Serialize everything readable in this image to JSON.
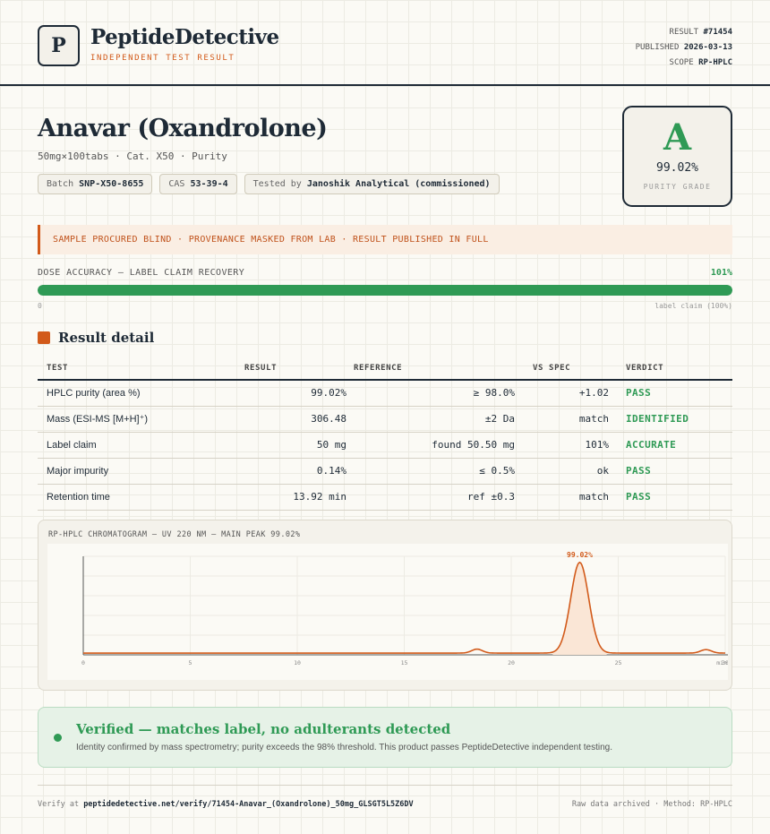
{
  "brand": {
    "logo_letter": "P",
    "name": "PeptideDetective",
    "tagline": "INDEPENDENT TEST RESULT"
  },
  "meta": {
    "result_label": "RESULT",
    "result_value": "#71454",
    "published_label": "PUBLISHED",
    "published_value": "2026-03-13",
    "scope_label": "SCOPE",
    "scope_value": "RP-HPLC"
  },
  "product": {
    "title": "Anavar (Oxandrolone)",
    "subtitle": "50mg×100tabs · Cat. X50 · Purity",
    "pills": {
      "batch_label": "Batch",
      "batch_value": "SNP-X50-8655",
      "cas_label": "CAS",
      "cas_value": "53-39-4",
      "tested_label": "Tested by",
      "tested_value": "Janoshik Analytical (commissioned)"
    }
  },
  "grade": {
    "letter": "A",
    "value": "99.02%",
    "label": "PURITY GRADE",
    "color": "#2f9a55"
  },
  "banner": {
    "text": "SAMPLE PROCURED BLIND · PROVENANCE MASKED FROM LAB · RESULT PUBLISHED IN FULL"
  },
  "dose": {
    "label": "DOSE ACCURACY — LABEL CLAIM RECOVERY",
    "value": "101%",
    "fill_fraction": 1.0,
    "min_label": "0",
    "max_label": "label claim (100%)"
  },
  "section": {
    "title": "Result detail"
  },
  "table": {
    "headers": [
      "TEST",
      "RESULT",
      "REFERENCE",
      "VS SPEC",
      "VERDICT"
    ],
    "rows": [
      {
        "test": "HPLC purity (area %)",
        "result": "99.02%",
        "reference": "≥ 98.0%",
        "vs": "+1.02",
        "verdict": "PASS"
      },
      {
        "test": "Mass (ESI-MS [M+H]⁺)",
        "result": "306.48",
        "reference": "±2 Da",
        "vs": "match",
        "verdict": "IDENTIFIED"
      },
      {
        "test": "Label claim",
        "result": "50 mg",
        "reference": "found 50.50 mg",
        "vs": "101%",
        "verdict": "ACCURATE"
      },
      {
        "test": "Major impurity",
        "result": "0.14%",
        "reference": "≤ 0.5%",
        "vs": "ok",
        "verdict": "PASS"
      },
      {
        "test": "Retention time",
        "result": "13.92 min",
        "reference": "ref ±0.3",
        "vs": "match",
        "verdict": "PASS"
      }
    ]
  },
  "chromatogram": {
    "title": "RP-HPLC CHROMATOGRAM — UV 220 NM — MAIN PEAK 99.02%"
  },
  "chart_data": {
    "type": "line",
    "title": "RP-HPLC CHROMATOGRAM — UV 220 NM — MAIN PEAK 99.02%",
    "xlabel": "min",
    "ylabel": "",
    "xlim": [
      0,
      30
    ],
    "ylim": [
      0,
      100
    ],
    "x_ticks": [
      0,
      5,
      10,
      15,
      20,
      25,
      30
    ],
    "x_tick_labels": [
      "0",
      "5",
      "10",
      "15",
      "20",
      "25",
      "30"
    ],
    "unit_label": "min",
    "baseline": 1.8,
    "peaks": [
      {
        "center": 18.4,
        "height": 4,
        "width": 0.25
      },
      {
        "center": 23.2,
        "height": 92,
        "width": 0.42
      },
      {
        "center": 29.1,
        "height": 3.5,
        "width": 0.25
      }
    ],
    "main_peak_label": "99.02%",
    "line_color": "#d25a1a",
    "fill_color": "#fae6d6",
    "grid": true
  },
  "verified": {
    "title": "Verified — matches label, no adulterants detected",
    "body": "Identity confirmed by mass spectrometry; purity exceeds the 98% threshold. This product passes PeptideDetective independent testing."
  },
  "footer": {
    "verify_prefix": "Verify at",
    "verify_url": "peptidedetective.net/verify/71454-Anavar_(Oxandrolone)_50mg_GLSGT5L5Z6DV",
    "right_text": "Raw data archived · Method: RP-HPLC"
  }
}
